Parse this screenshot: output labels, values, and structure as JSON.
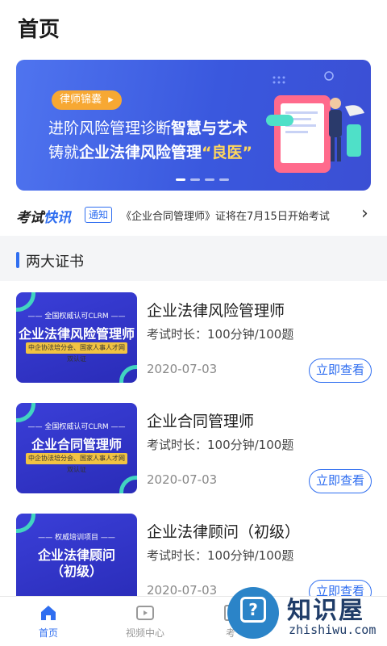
{
  "header": {
    "title": "首页"
  },
  "banner": {
    "badge": "律师锦囊",
    "line1_prefix": "进阶风险管理诊断",
    "line1_highlight": "智慧与艺术",
    "line2_prefix": "铸就",
    "line2_highlight": "企业法律风险管理",
    "line2_quote": "“良医”",
    "dot_count": 4,
    "active_dot": 0
  },
  "news": {
    "logo_part1": "考试",
    "logo_part2": "快讯",
    "tag": "通知",
    "text": "《企业合同管理师》证将在7月15日开始考试",
    "arrow": "›"
  },
  "section": {
    "title": "两大证书"
  },
  "courses": [
    {
      "thumb_top": "—— 全国权威认可CLRM ——",
      "thumb_title": "企业法律风险管理师",
      "thumb_sub": "中企协法培分会、国家人事人才网双认证",
      "title": "企业法律风险管理师",
      "meta": "考试时长：100分钟/100题",
      "date": "2020-07-03",
      "button": "立即查看"
    },
    {
      "thumb_top": "—— 全国权威认可CLRM ——",
      "thumb_title": "企业合同管理师",
      "thumb_sub": "中企协法培分会、国家人事人才网双认证",
      "title": "企业合同管理师",
      "meta": "考试时长：100分钟/100题",
      "date": "2020-07-03",
      "button": "立即查看"
    },
    {
      "thumb_top": "—— 权威培训项目 ——",
      "thumb_title": "企业法律顾问",
      "thumb_title2": "（初级）",
      "title": "企业法律顾问（初级）",
      "meta": "考试时长：100分钟/100题",
      "date": "2020-07-03",
      "button": "立即查看"
    }
  ],
  "tabbar": [
    {
      "label": "首页",
      "icon": "home-icon",
      "active": true
    },
    {
      "label": "视频中心",
      "icon": "video-icon",
      "active": false
    },
    {
      "label": "考",
      "icon": "exam-icon",
      "active": false
    }
  ],
  "watermark": {
    "text": "知识屋",
    "url": "zhishiwu.com"
  },
  "colors": {
    "accent": "#2f6ef0",
    "banner_bg": "#3a58de",
    "badge": "#f7a833",
    "highlight": "#ffd75c"
  }
}
